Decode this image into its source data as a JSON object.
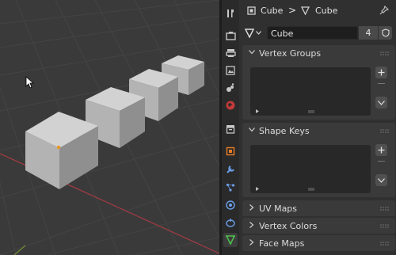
{
  "breadcrumb": {
    "object_name": "Cube",
    "separator": ">",
    "data_name": "Cube"
  },
  "mesh_datablock": {
    "name": "Cube",
    "users": "4"
  },
  "panels": {
    "vertex_groups": "Vertex Groups",
    "shape_keys": "Shape Keys",
    "uv_maps": "UV Maps",
    "vertex_colors": "Vertex Colors",
    "face_maps": "Face Maps"
  },
  "property_tabs": [
    "tool-icon",
    "render-icon",
    "output-icon",
    "view-layer-icon",
    "scene-icon",
    "world-icon",
    "collection-icon",
    "object-icon",
    "modifier-icon",
    "particles-icon",
    "physics-icon",
    "constraints-icon",
    "object-data-icon"
  ],
  "colors": {
    "accent_active": "#3d3d3d",
    "panel_bg": "#3a3a3a",
    "x_axis": "#9c3a42",
    "y_axis": "#6e8a36",
    "object_data_green": "#4ec24e"
  }
}
